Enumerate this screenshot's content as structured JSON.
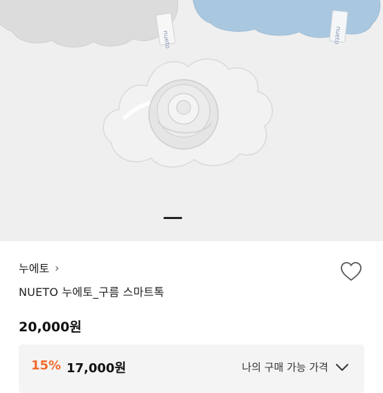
{
  "product": {
    "brand": "누에토",
    "brand_chevron": "›",
    "title": "NUETO 누에토_구름 스마트톡",
    "price": "20,000원",
    "discount_percent": "15%",
    "discount_price": "17,000원",
    "my_price_label": "나의 구매 가능 가격",
    "tag_text": "nueto"
  },
  "gallery": {
    "current_index": 1,
    "total": 1
  },
  "colors": {
    "accent": "#f26a2c",
    "hero_bg": "#efefef",
    "cloud_blue": "#a9c7df"
  },
  "icons": {
    "wishlist": "heart-icon",
    "expand": "chevron-down-icon",
    "brand_link": "chevron-right-icon"
  }
}
